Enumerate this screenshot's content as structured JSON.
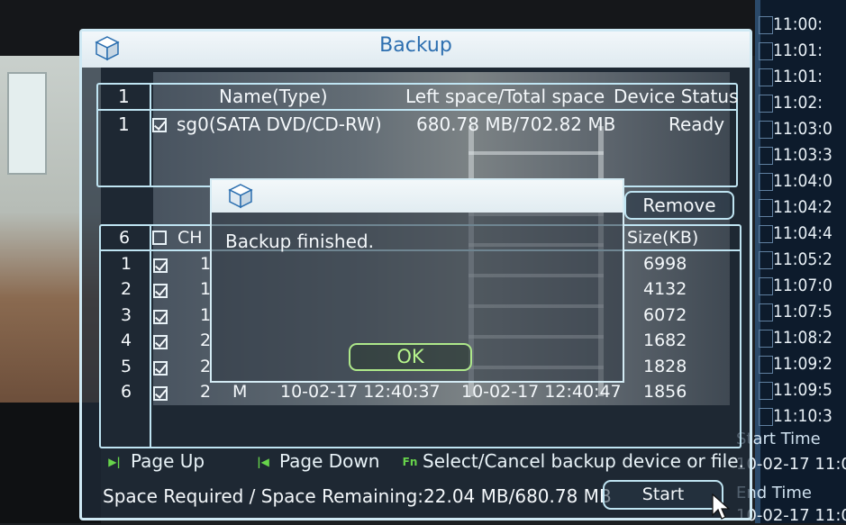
{
  "backup_window": {
    "title": "Backup",
    "device_table": {
      "header": {
        "count": "1",
        "name": "Name(Type)",
        "space": "Left space/Total space",
        "status": "Device Status"
      },
      "rows": [
        {
          "index": "1",
          "checked": true,
          "name": "sg0(SATA DVD/CD-RW)",
          "space": "680.78 MB/702.82 MB",
          "status": "Ready"
        }
      ]
    },
    "remove_label": "Remove",
    "file_table": {
      "header": {
        "count": "6",
        "ch": "CH",
        "size": "Size(KB)"
      },
      "rows": [
        {
          "index": "1",
          "checked": true,
          "ch": "1",
          "type": "",
          "start": "",
          "end": "",
          "size": "6998"
        },
        {
          "index": "2",
          "checked": true,
          "ch": "1",
          "type": "",
          "start": "",
          "end": "",
          "size": "4132"
        },
        {
          "index": "3",
          "checked": true,
          "ch": "1",
          "type": "",
          "start": "",
          "end": "",
          "size": "6072"
        },
        {
          "index": "4",
          "checked": true,
          "ch": "2",
          "type": "",
          "start": "",
          "end": "",
          "size": "1682"
        },
        {
          "index": "5",
          "checked": true,
          "ch": "2",
          "type": "",
          "start": "",
          "end": "",
          "size": "1828"
        },
        {
          "index": "6",
          "checked": true,
          "ch": "2",
          "type": "M",
          "start": "10-02-17 12:40:37",
          "end": "10-02-17 12:40:47",
          "size": "1856"
        }
      ]
    },
    "hints": {
      "page_up": "Page Up",
      "page_down": "Page Down",
      "select_cancel": "Select/Cancel backup device or file."
    },
    "space_text": "Space Required / Space Remaining:22.04 MB/680.78 MB",
    "start_label": "Start"
  },
  "alert": {
    "message": "Backup finished.",
    "ok_label": "OK"
  },
  "right_panel": {
    "times": [
      "11:00:",
      "11:01:",
      "11:01:",
      "11:02:",
      "11:03:0",
      "11:03:3",
      "11:04:0",
      "11:04:2",
      "11:04:4",
      "11:05:2",
      "11:07:0",
      "11:07:5",
      "11:08:2",
      "11:09:2",
      "11:09:5",
      "11:10:3"
    ],
    "start_time_label": "Start Time",
    "start_time_value": "10-02-17 11:0",
    "end_time_label": "End Time",
    "end_time_value": "10-02-17 11:0"
  },
  "colors": {
    "accent_text": "#2d6fb0",
    "ok_green": "#b6f48c",
    "frame": "#bfe4f2"
  },
  "icons": [
    "cube-icon",
    "checkbox-icon",
    "page-up-icon",
    "page-down-icon",
    "fn-icon",
    "mouse-cursor-icon"
  ]
}
